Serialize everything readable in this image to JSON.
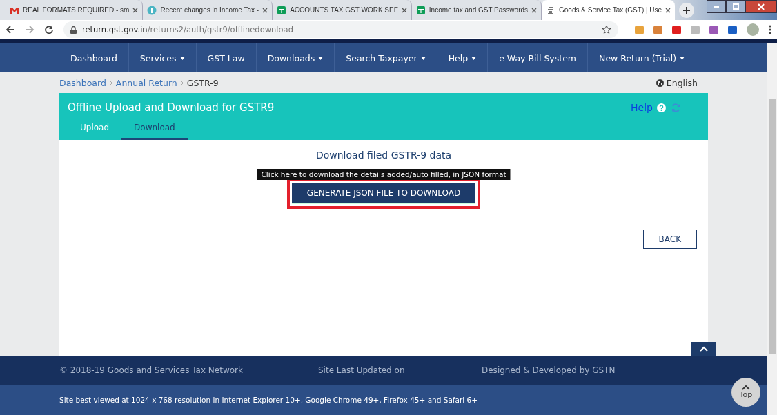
{
  "browser": {
    "tabs": [
      {
        "title": "REAL FORMATS REQUIRED - sm",
        "kind": "mail",
        "selected": false
      },
      {
        "title": "Recent changes in Income Tax -",
        "kind": "info",
        "selected": false
      },
      {
        "title": "ACCOUNTS TAX GST WORK SEF",
        "kind": "sheet",
        "selected": false
      },
      {
        "title": "Income tax and GST Passwords",
        "kind": "sheet",
        "selected": false
      },
      {
        "title": "Goods & Service Tax (GST) | Use",
        "kind": "emblem",
        "selected": true
      }
    ],
    "url_host": "return.gst.gov.in",
    "url_path": "/returns2/auth/gstr9/offlinedownload"
  },
  "nav": [
    {
      "label": "Dashboard",
      "dropdown": false
    },
    {
      "label": "Services",
      "dropdown": true
    },
    {
      "label": "GST Law",
      "dropdown": false
    },
    {
      "label": "Downloads",
      "dropdown": true
    },
    {
      "label": "Search Taxpayer",
      "dropdown": true
    },
    {
      "label": "Help",
      "dropdown": true
    },
    {
      "label": "e-Way Bill System",
      "dropdown": false
    },
    {
      "label": "New Return (Trial)",
      "dropdown": true
    }
  ],
  "breadcrumb": [
    {
      "label": "Dashboard",
      "link": true
    },
    {
      "label": "Annual Return",
      "link": true
    },
    {
      "label": "GSTR-9",
      "link": false
    }
  ],
  "language": "English",
  "panel": {
    "title": "Offline Upload and Download for GSTR9",
    "help": "Help",
    "tabs": [
      {
        "label": "Upload",
        "selected": false
      },
      {
        "label": "Download",
        "selected": true
      }
    ]
  },
  "content": {
    "heading": "Download filed GSTR-9 data",
    "tooltip": "Click here to download the details added/auto filled, in JSON format",
    "button": "GENERATE JSON FILE TO DOWNLOAD",
    "button_marked": true,
    "back": "BACK"
  },
  "footer": {
    "copyright": "© 2018-19 Goods and Services Tax Network",
    "updated": "Site Last Updated on",
    "designed": "Designed & Developed by GSTN",
    "note": "Site best viewed at 1024 x 768 resolution in Internet Explorer 10+, Google Chrome 49+, Firefox 45+ and Safari 6+",
    "top": "Top"
  }
}
